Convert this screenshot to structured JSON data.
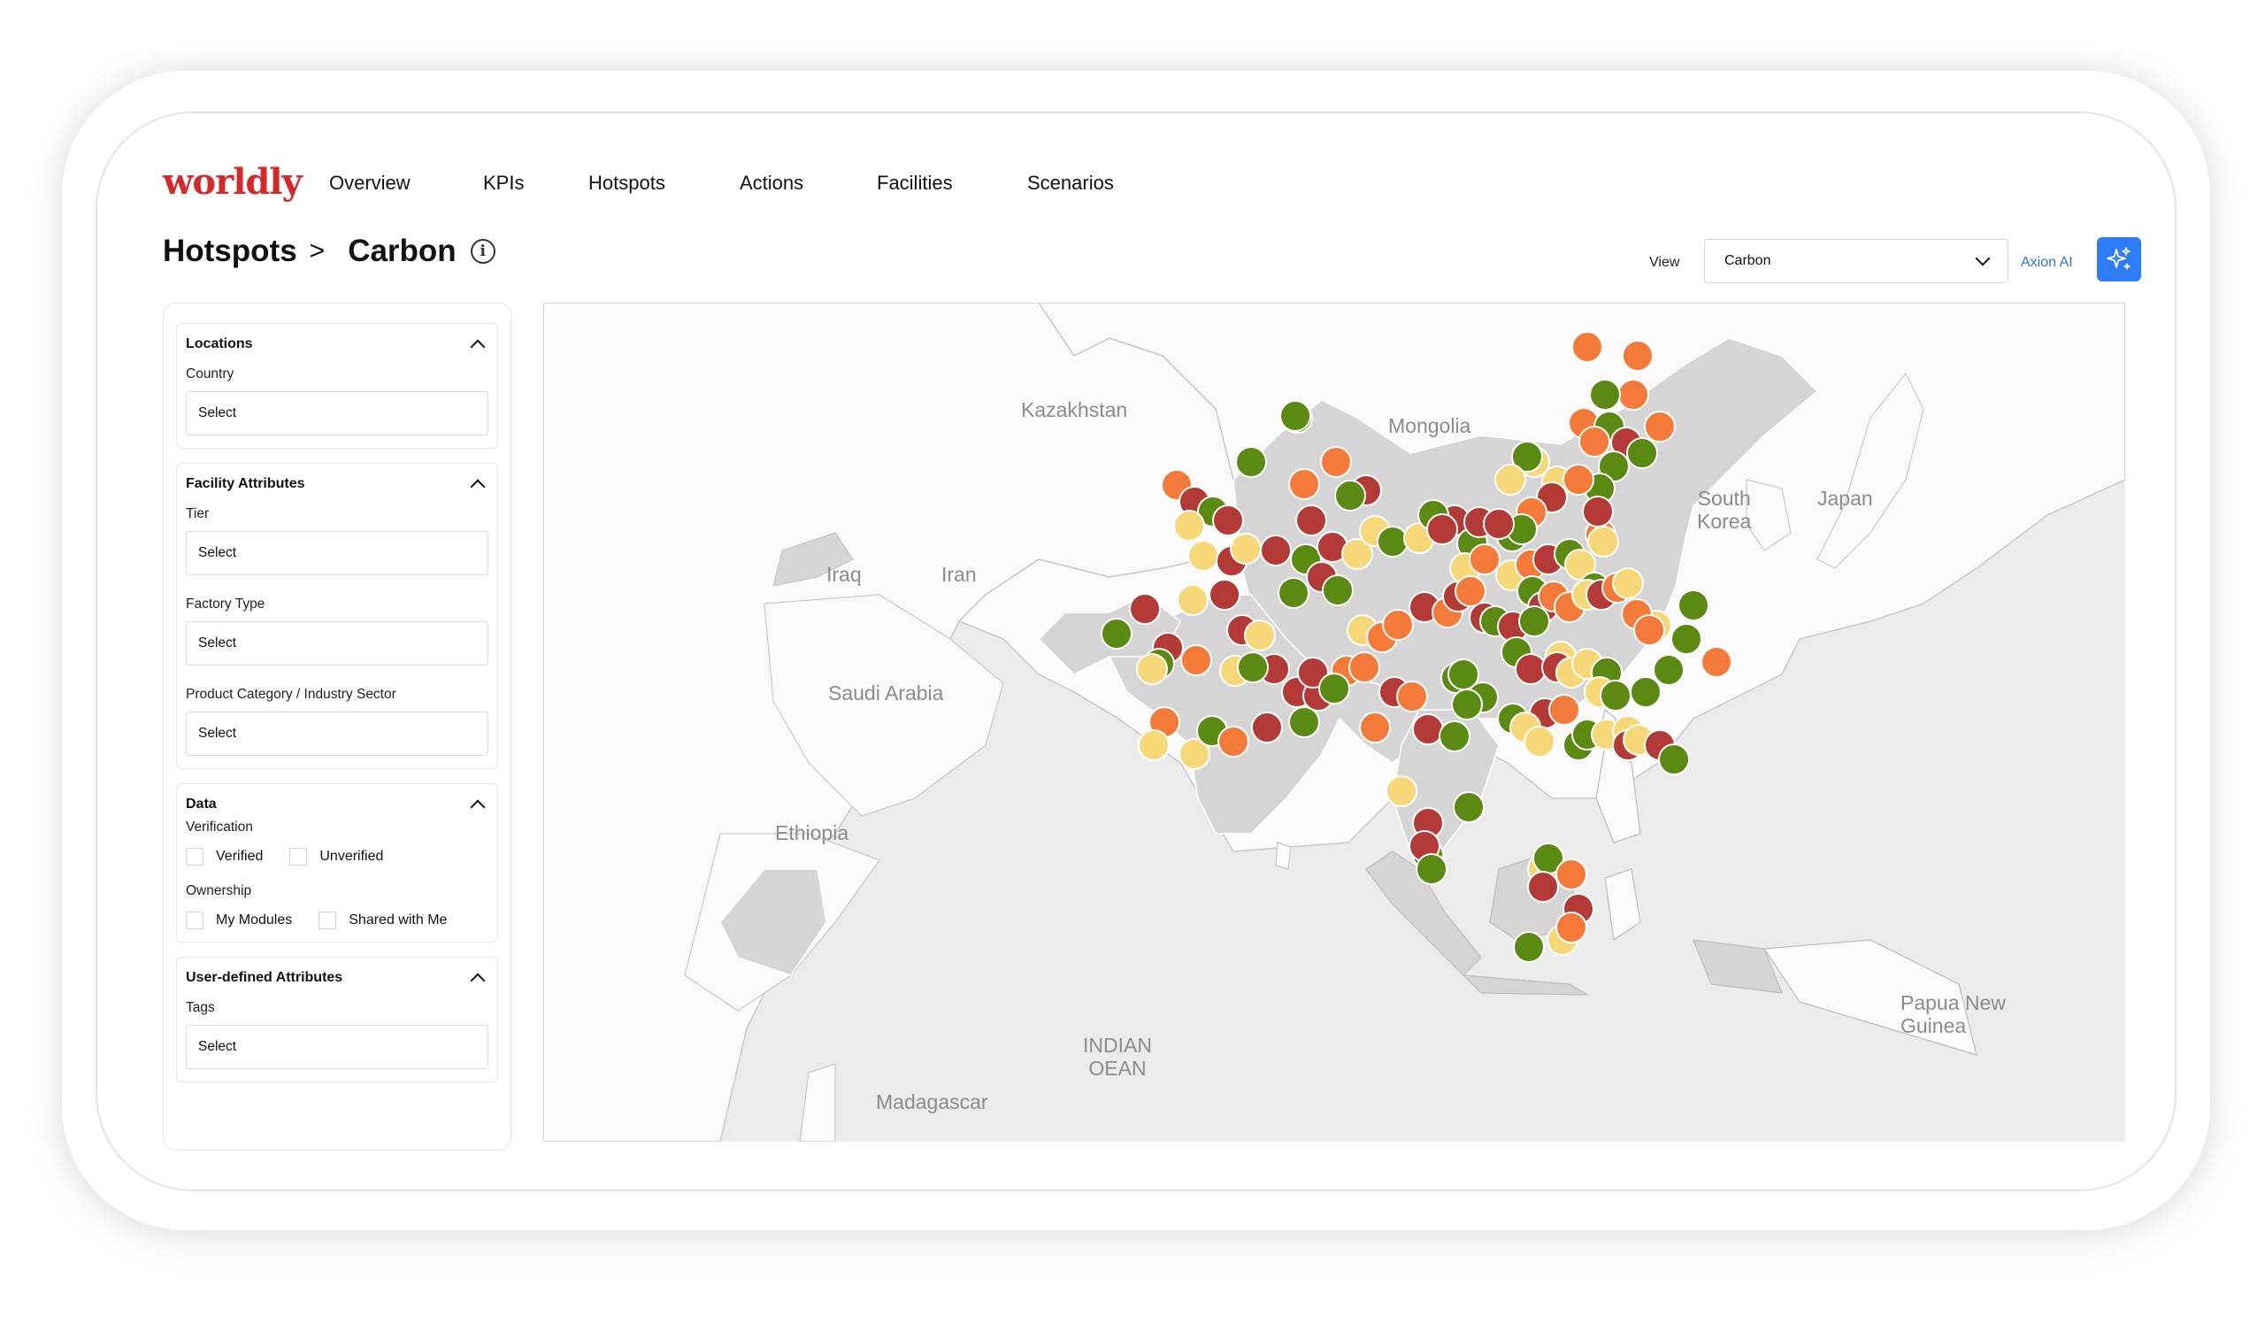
{
  "brand": "worldly",
  "nav": [
    "Overview",
    "KPIs",
    "Hotspots",
    "Actions",
    "Facilities",
    "Scenarios"
  ],
  "breadcrumb": {
    "parent": "Hotspots",
    "separator": ">",
    "current": "Carbon"
  },
  "view": {
    "label": "View",
    "selected": "Carbon"
  },
  "axion": {
    "label": "Axion AI"
  },
  "sidebar": {
    "locations": {
      "title": "Locations",
      "country_label": "Country",
      "country_value": "Select"
    },
    "facility": {
      "title": "Facility Attributes",
      "tier_label": "Tier",
      "tier_value": "Select",
      "factory_label": "Factory Type",
      "factory_value": "Select",
      "product_label": "Product Category / Industry Sector",
      "product_value": "Select"
    },
    "data": {
      "title": "Data",
      "verification_label": "Verification",
      "verified": "Verified",
      "unverified": "Unverified",
      "ownership_label": "Ownership",
      "my_modules": "My Modules",
      "shared": "Shared with Me"
    },
    "user_defined": {
      "title": "User-defined Attributes",
      "tags_label": "Tags",
      "tags_value": "Select"
    }
  },
  "map": {
    "labels": {
      "kazakhstan": "Kazakhstan",
      "mongolia": "Mongolia",
      "iraq": "Iraq",
      "iran": "Iran",
      "saudi": "Saudi Arabia",
      "ethiopia": "Ethiopia",
      "south_korea": "South\nKorea",
      "japan": "Japan",
      "png": "Papua New\nGuinea",
      "indian_ocean": "INDIAN\nOEAN",
      "madagascar": "Madagascar"
    },
    "colors": {
      "green": "#5a8a12",
      "yellow": "#f6d878",
      "orange": "#f47a3a",
      "red": "#b33a36",
      "land_highlight": "#d5d5d6",
      "land": "#fafafa",
      "water": "#ebebeb"
    }
  }
}
